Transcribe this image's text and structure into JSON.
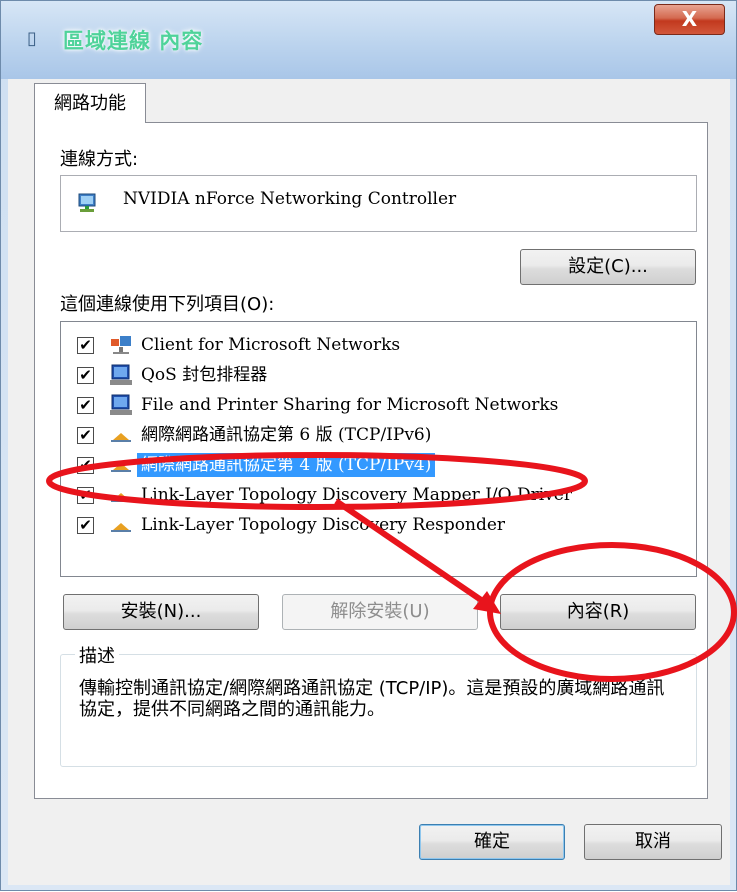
{
  "window": {
    "title": "區域連線 內容",
    "close_label": "X"
  },
  "tabs": [
    {
      "label": "網路功能"
    }
  ],
  "connect_using": {
    "label": "連線方式:",
    "adapter_name": "NVIDIA nForce Networking Controller",
    "configure_button": "設定(C)..."
  },
  "items_section": {
    "label": "這個連線使用下列項目(O):",
    "items": [
      {
        "checked": true,
        "icon": "network-client-icon",
        "text": "Client for Microsoft Networks"
      },
      {
        "checked": true,
        "icon": "computer-icon",
        "text": "QoS 封包排程器"
      },
      {
        "checked": true,
        "icon": "computer-icon",
        "text": "File and Printer Sharing for Microsoft Networks"
      },
      {
        "checked": true,
        "icon": "protocol-icon",
        "text": "網際網路通訊協定第 6 版 (TCP/IPv6)"
      },
      {
        "checked": true,
        "icon": "protocol-icon",
        "text": "網際網路通訊協定第 4 版 (TCP/IPv4)",
        "selected": true
      },
      {
        "checked": true,
        "icon": "protocol-icon",
        "text": "Link-Layer Topology Discovery Mapper I/O Driver"
      },
      {
        "checked": true,
        "icon": "protocol-icon",
        "text": "Link-Layer Topology Discovery Responder"
      }
    ]
  },
  "buttons": {
    "install": "安裝(N)...",
    "uninstall": "解除安裝(U)",
    "properties": "內容(R)",
    "ok": "確定",
    "cancel": "取消"
  },
  "description": {
    "title": "描述",
    "text": "傳輸控制通訊協定/網際網路通訊協定 (TCP/IP)。這是預設的廣域網路通訊協定，提供不同網路之間的通訊能力。"
  },
  "colors": {
    "selection": "#3399ff",
    "annotation": "#e8141c",
    "title_text": "#4fd39a"
  }
}
